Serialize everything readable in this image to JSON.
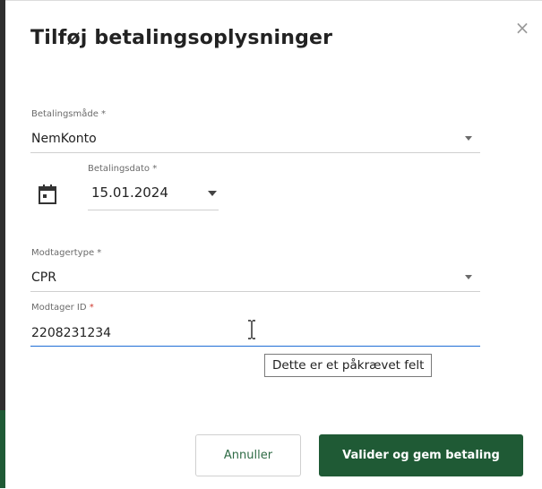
{
  "dialog": {
    "title": "Tilføj betalingsoplysninger",
    "close_glyph": "×"
  },
  "payment_method": {
    "label": "Betalingsmåde *",
    "value": "NemKonto"
  },
  "payment_date": {
    "label": "Betalingsdato *",
    "value": "15.01.2024",
    "icon": "calendar-icon"
  },
  "recipient_type": {
    "label": "Modtagertype *",
    "value": "CPR"
  },
  "recipient_id": {
    "label": "Modtager ID",
    "required_mark": "*",
    "value": "2208231234",
    "validation_tooltip": "Dette er et påkrævet felt"
  },
  "buttons": {
    "cancel": "Annuller",
    "submit": "Valider og gem betaling"
  },
  "colors": {
    "primary": "#1f5a35",
    "focus": "#1f6fd6",
    "required": "#d03a2f"
  }
}
